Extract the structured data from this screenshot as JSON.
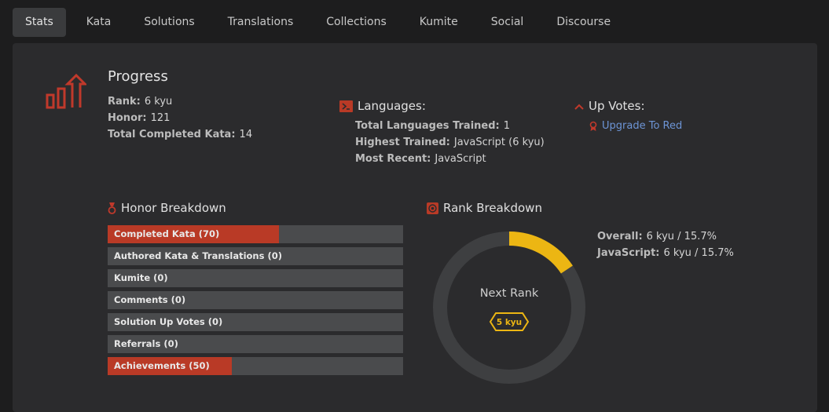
{
  "tabs": [
    "Stats",
    "Kata",
    "Solutions",
    "Translations",
    "Collections",
    "Kumite",
    "Social",
    "Discourse"
  ],
  "active_tab": "Stats",
  "progress": {
    "title": "Progress",
    "rank_label": "Rank:",
    "rank_value": "6 kyu",
    "honor_label": "Honor:",
    "honor_value": "121",
    "completed_label": "Total Completed Kata:",
    "completed_value": "14"
  },
  "languages": {
    "title": "Languages:",
    "trained_label": "Total Languages Trained:",
    "trained_value": "1",
    "highest_label": "Highest Trained:",
    "highest_value": "JavaScript (6 kyu)",
    "recent_label": "Most Recent:",
    "recent_value": "JavaScript"
  },
  "upvotes": {
    "title": "Up Votes:",
    "link": "Upgrade To Red"
  },
  "honor_breakdown": {
    "title": "Honor Breakdown",
    "items": [
      {
        "label": "Completed Kata (70)",
        "fill": 0.58
      },
      {
        "label": "Authored Kata & Translations (0)",
        "fill": 0
      },
      {
        "label": "Kumite (0)",
        "fill": 0
      },
      {
        "label": "Comments (0)",
        "fill": 0
      },
      {
        "label": "Solution Up Votes (0)",
        "fill": 0
      },
      {
        "label": "Referrals (0)",
        "fill": 0
      },
      {
        "label": "Achievements (50)",
        "fill": 0.42
      }
    ]
  },
  "rank_breakdown": {
    "title": "Rank Breakdown",
    "center_label": "Next Rank",
    "next_rank": "5 kyu",
    "progress_fraction": 0.157,
    "overall_label": "Overall:",
    "overall_value": "6 kyu / 15.7%",
    "js_label": "JavaScript:",
    "js_value": "6 kyu / 15.7%"
  },
  "colors": {
    "accent": "#b93a26",
    "rank_yellow": "#ecb613",
    "link": "#6d95d6",
    "panel": "#2b2b2d",
    "bar_track": "#4a4b4d"
  }
}
